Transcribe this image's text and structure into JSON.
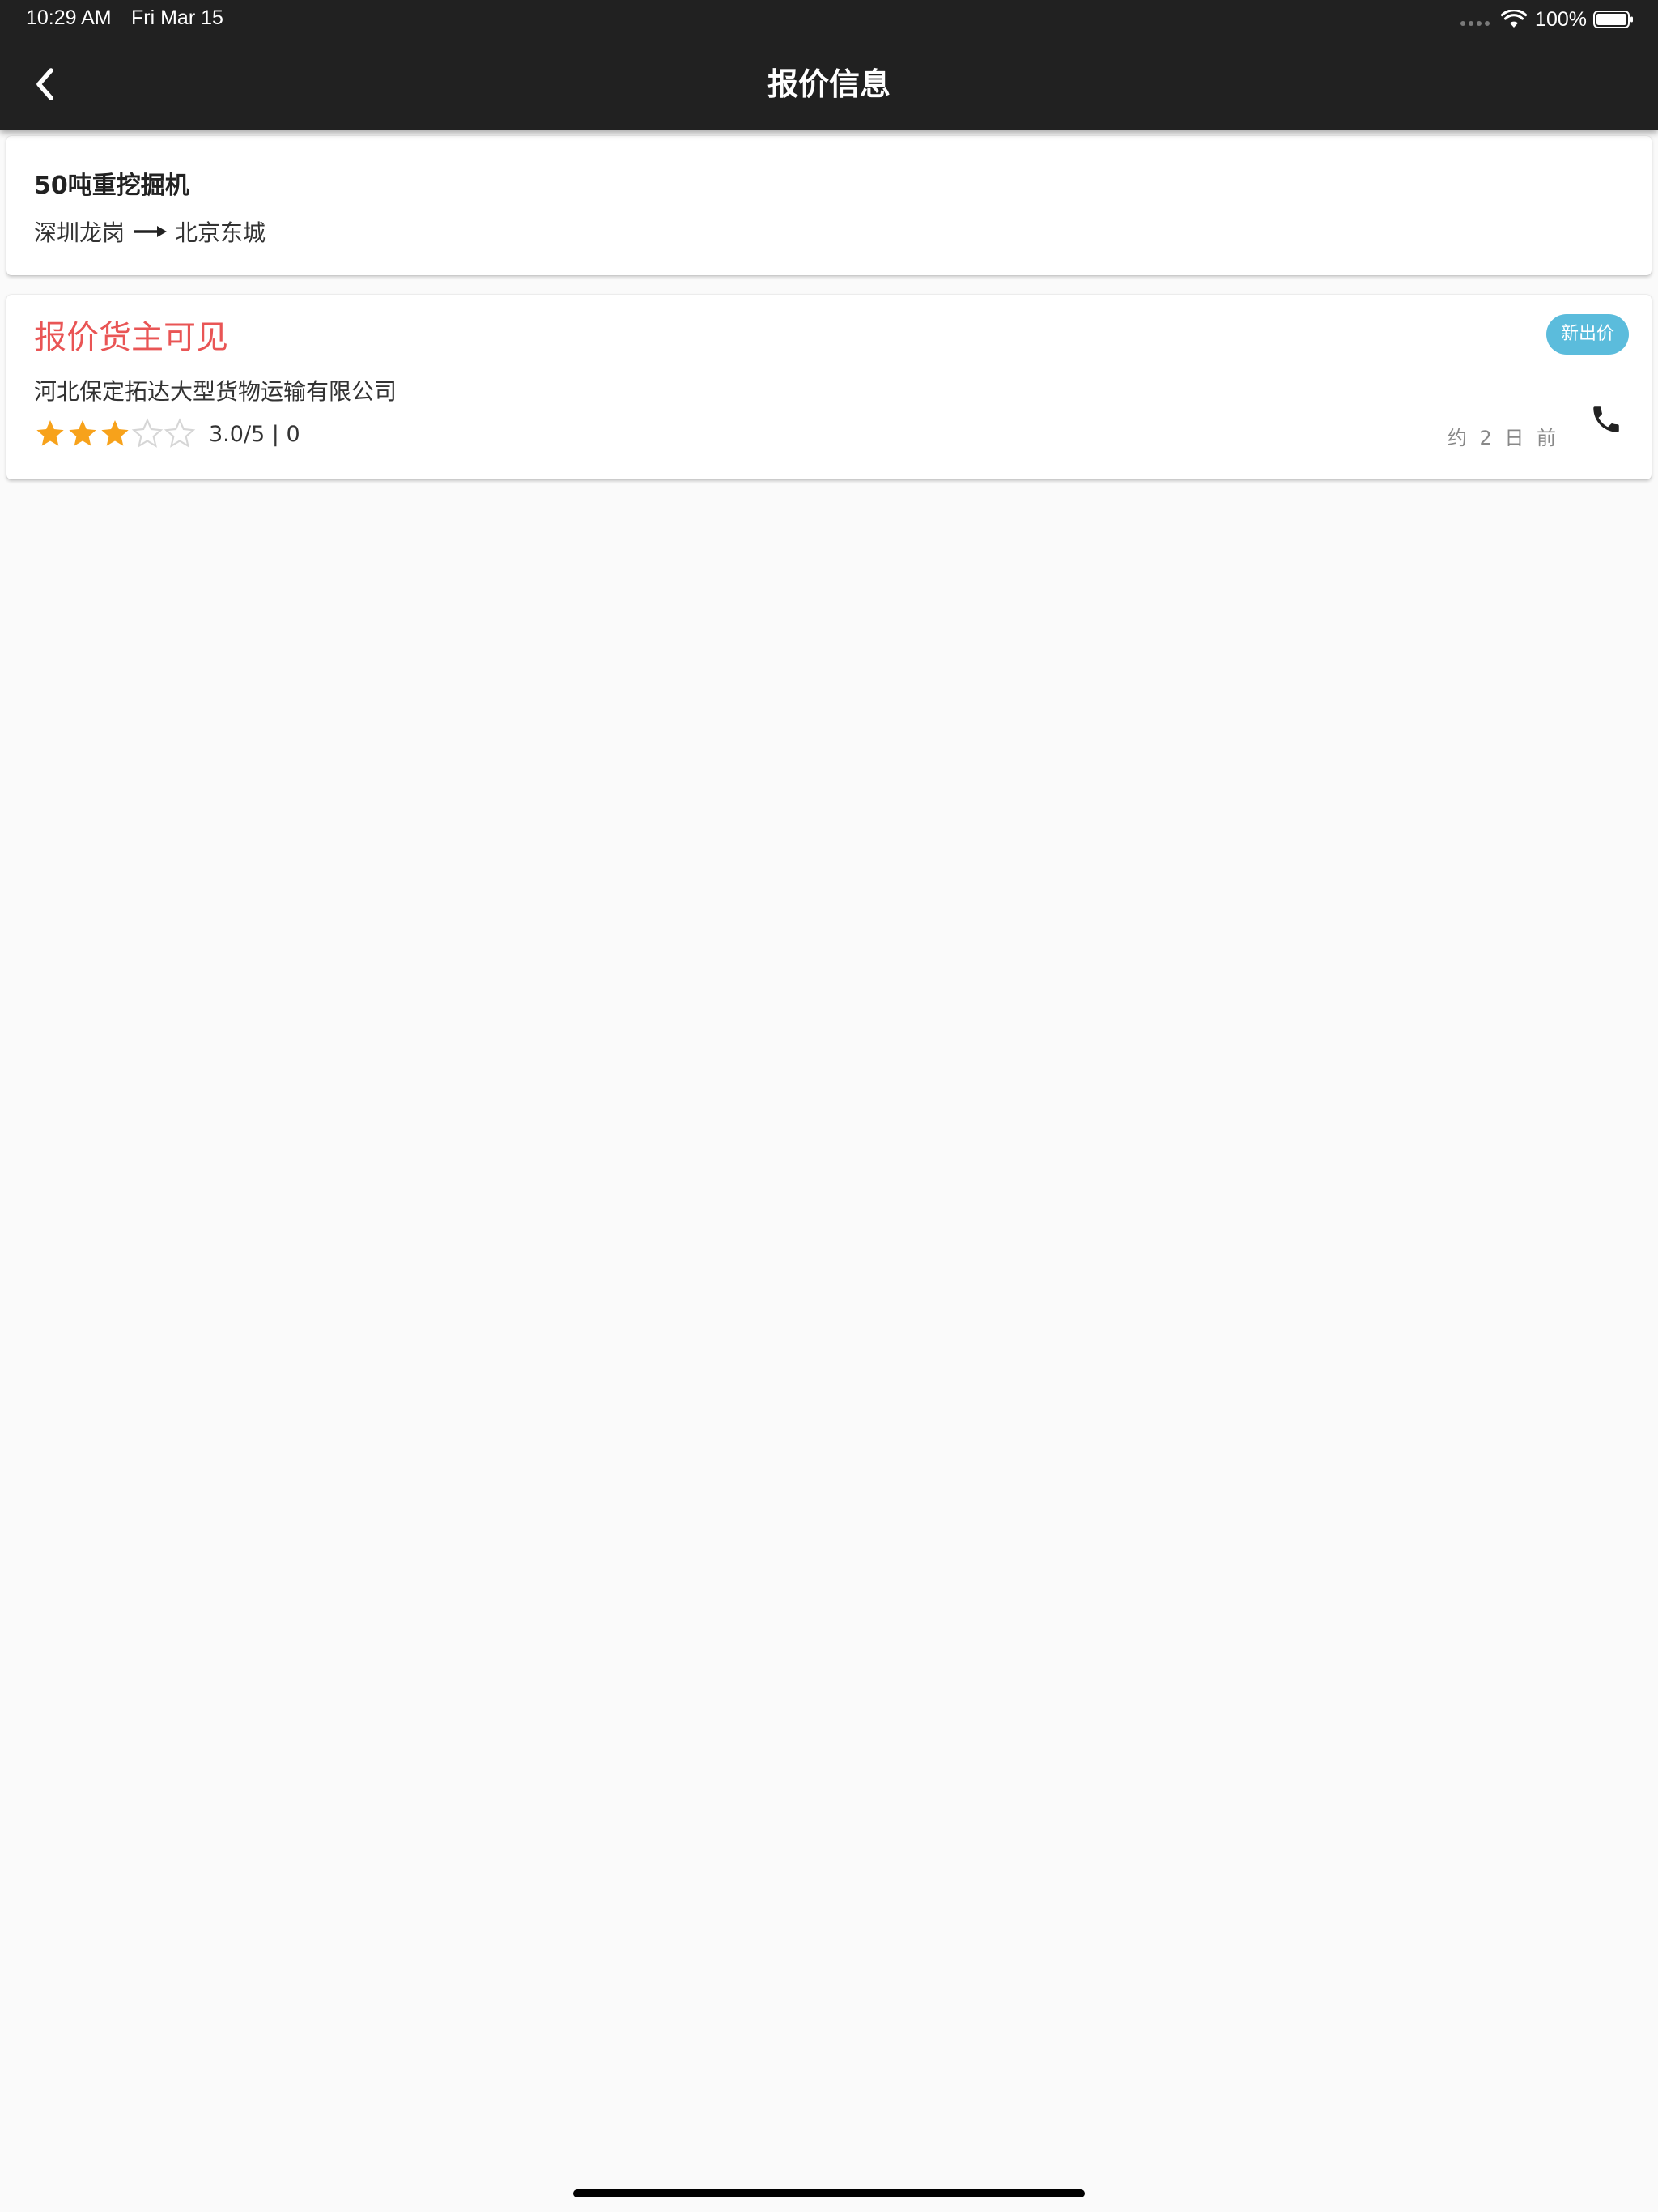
{
  "status_bar": {
    "time": "10:29 AM",
    "date": "Fri Mar 15",
    "battery": "100%"
  },
  "header": {
    "title": "报价信息",
    "back_icon": "chevron-left-icon",
    "background": "#212121"
  },
  "cargo": {
    "name": "50吨重挖掘机",
    "origin": "深圳龙岗",
    "destination": "北京东城"
  },
  "quote": {
    "visibility_note": "报价货主可见",
    "badge": "新出价",
    "company": "河北保定拓达大型货物运输有限公司",
    "rating_stars": 3,
    "rating_max": 5,
    "rating_text": "3.0/5 | 0",
    "time_ago": "约 2 日 前",
    "phone_icon": "phone-icon"
  },
  "colors": {
    "accent_red": "#e95555",
    "badge_blue": "#5bbcdc",
    "star_filled": "#f7a21b",
    "star_empty": "#d6d6d6"
  }
}
